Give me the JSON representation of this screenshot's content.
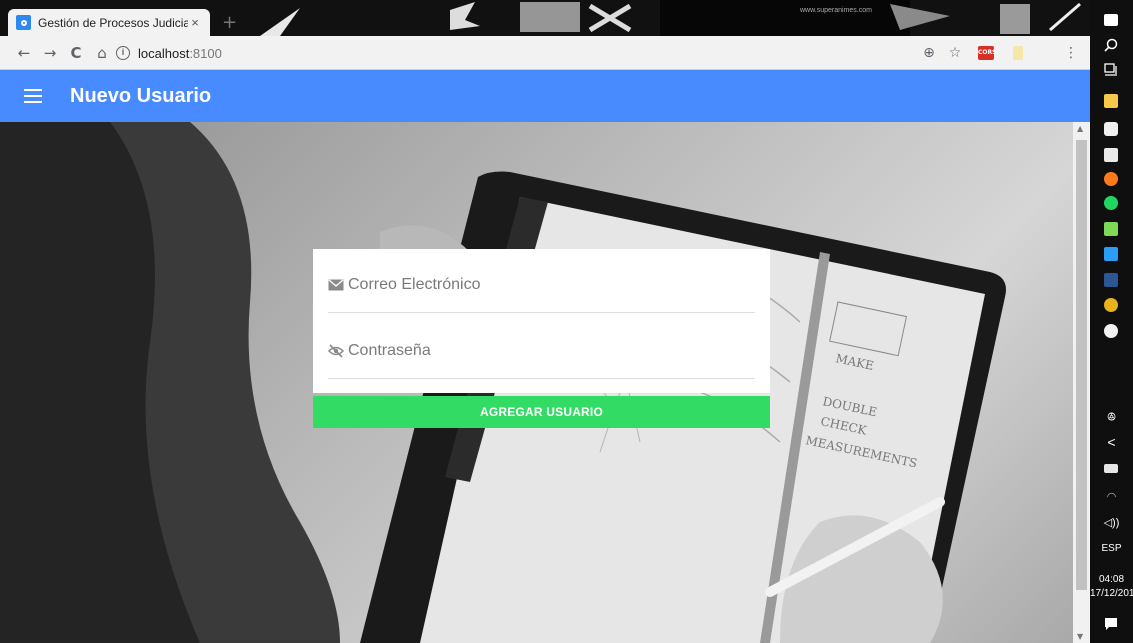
{
  "browser": {
    "tab_title": "Gestión de Procesos Judiciales",
    "tab_close": "×",
    "new_tab": "+",
    "url_host": "localhost",
    "url_port": ":8100",
    "ext_badge": "CORS",
    "watermark": "www.superanimes.com",
    "icons": {
      "back": "←",
      "forward": "→",
      "reload": "C",
      "home": "⌂",
      "info": "i",
      "zoom": "⊕",
      "star": "☆",
      "menu": "⋮"
    }
  },
  "app": {
    "title": "Nuevo Usuario",
    "accent": "#488aff",
    "button_color": "#32db64"
  },
  "form": {
    "email_placeholder": "Correo Electrónico",
    "password_placeholder": "Contraseña",
    "submit_label": "AGREGAR USUARIO"
  },
  "taskbar": {
    "language": "ESP",
    "time": "04:08",
    "date": "17/12/201",
    "icons": [
      "task-view-icon",
      "search-icon",
      "timeline-icon",
      "file-explorer-icon",
      "store-icon",
      "mail-icon",
      "firefox-icon",
      "spotify-icon",
      "notepad-icon",
      "vscode-icon",
      "word-icon",
      "chrome-icon",
      "emoji-icon",
      "people-icon",
      "chevron-icon",
      "battery-icon",
      "wifi-icon",
      "volume-icon",
      "notification-icon"
    ]
  }
}
